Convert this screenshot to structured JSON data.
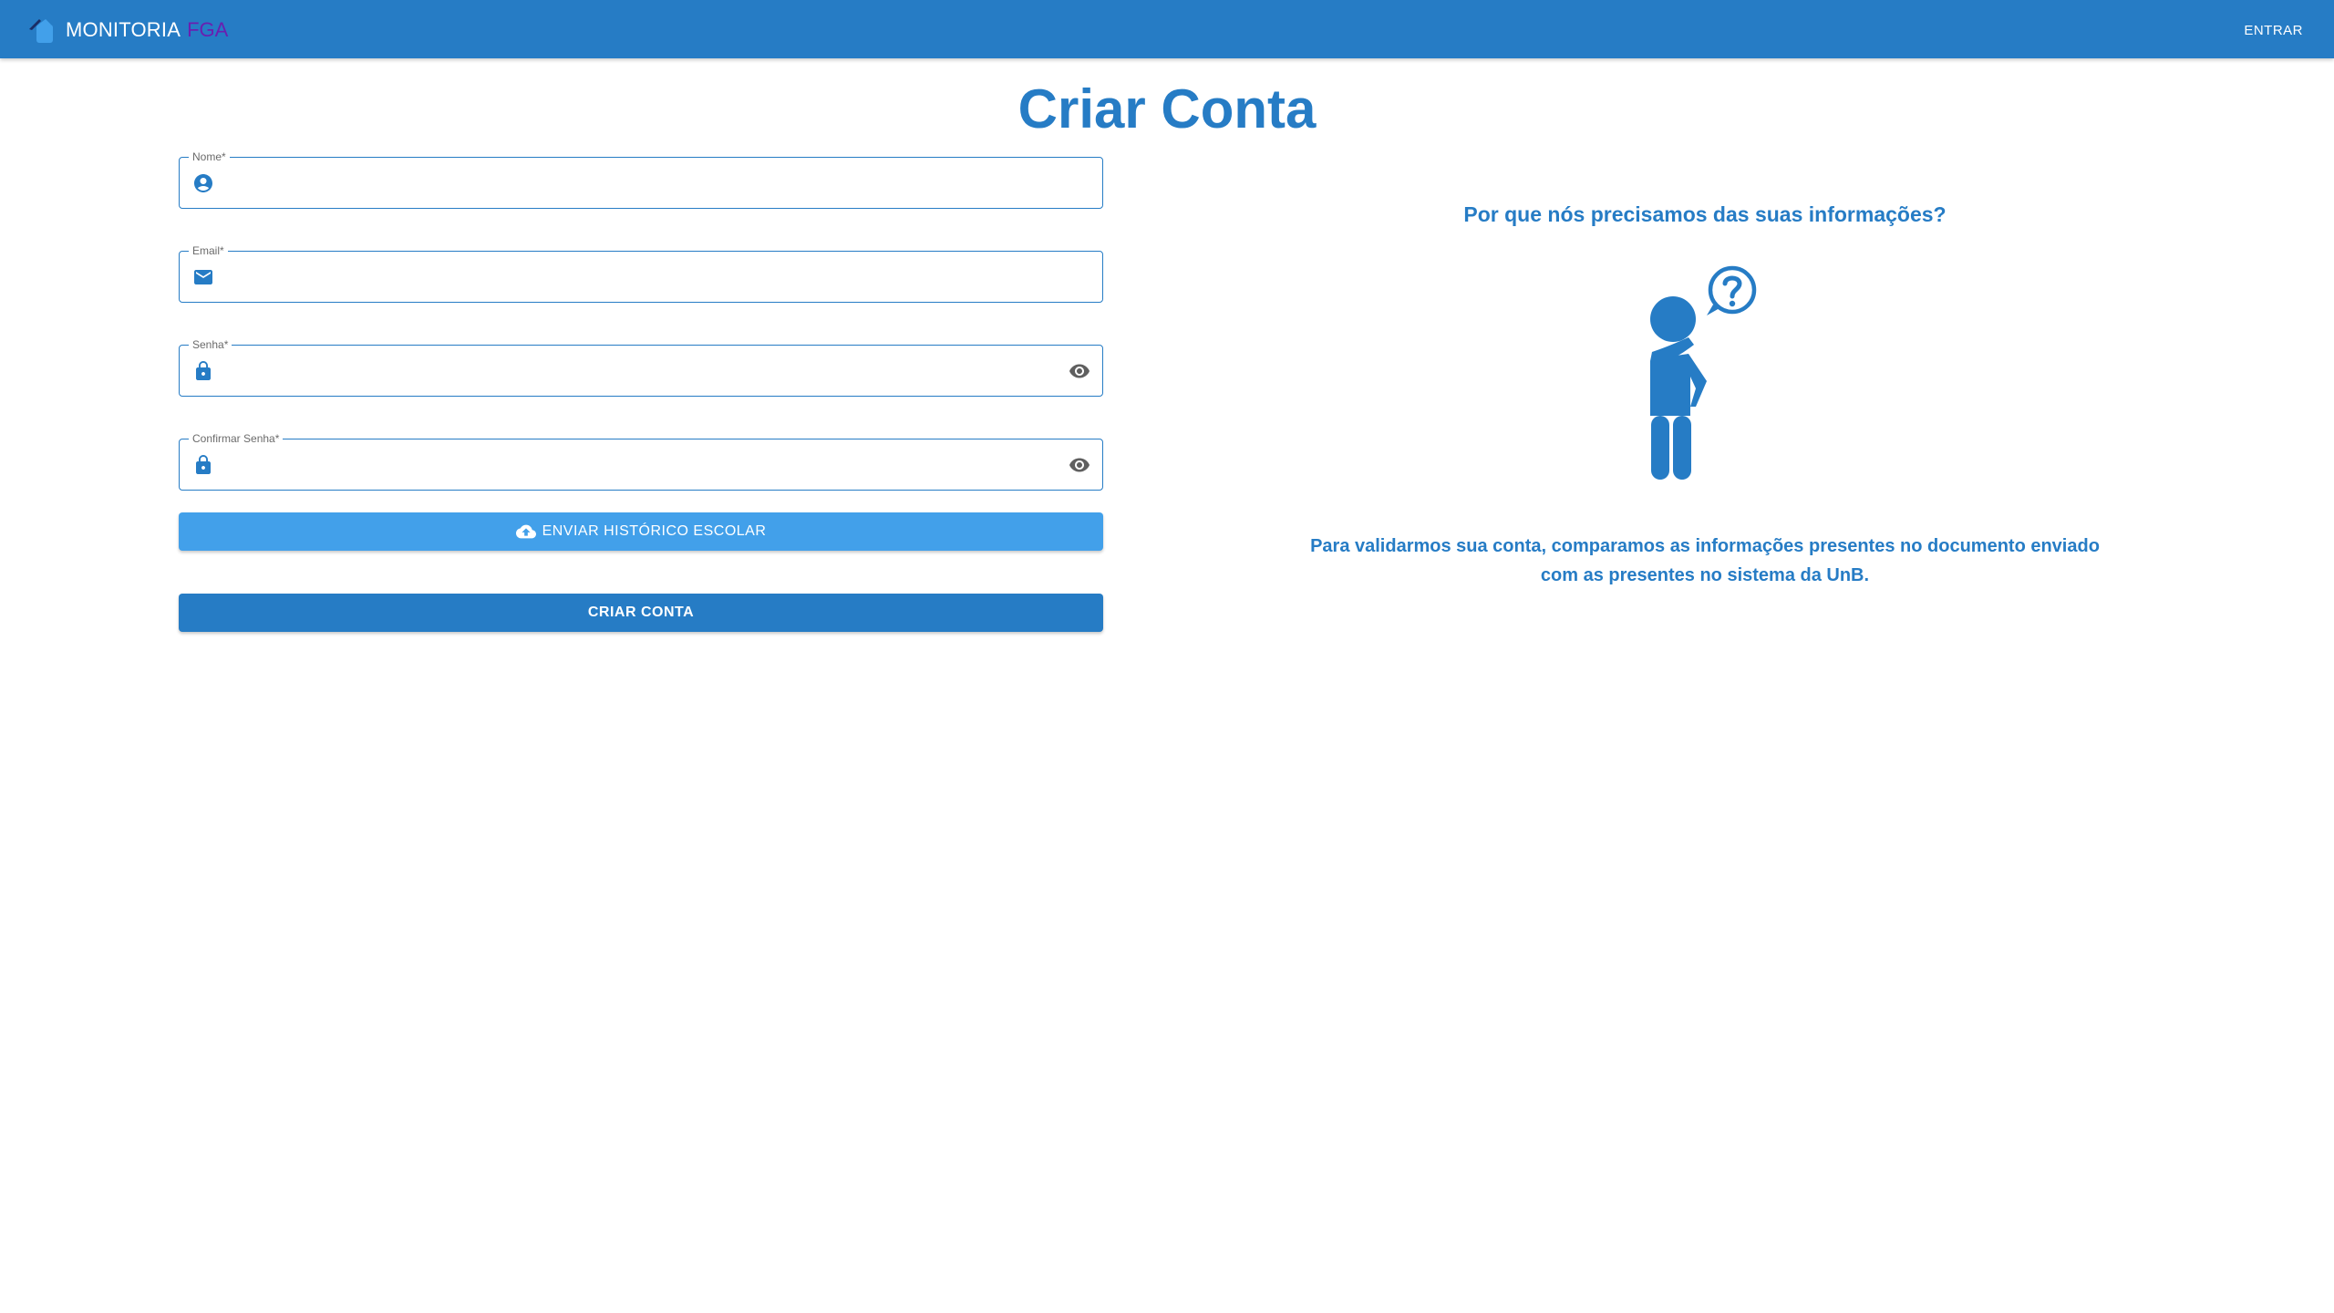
{
  "app": {
    "brand_main": "MONITORIA",
    "brand_accent": "FGA"
  },
  "header": {
    "login_label": "ENTRAR"
  },
  "page": {
    "title": "Criar Conta"
  },
  "form": {
    "fields": [
      {
        "label": "Nome*",
        "value": "",
        "icon": "account-circle-icon"
      },
      {
        "label": "Email*",
        "value": "",
        "icon": "mail-icon"
      },
      {
        "label": "Senha*",
        "value": "",
        "icon": "lock-icon",
        "toggle_icon": "eye-icon"
      },
      {
        "label": "Confirmar Senha*",
        "value": "",
        "icon": "lock-icon",
        "toggle_icon": "eye-icon"
      }
    ],
    "upload_label": "ENVIAR HISTÓRICO ESCOLAR",
    "upload_icon": "cloud-upload-icon",
    "submit_label": "CRIAR CONTA"
  },
  "info": {
    "heading": "Por que nós precisamos das suas informações?",
    "illustration": "person-question-icon",
    "text": "Para validarmos sua conta, comparamos as informações presentes no documento enviado com as presentes no sistema da UnB."
  },
  "colors": {
    "primary": "#267cc5",
    "secondary": "#42a0ea",
    "brand_accent": "#6a1fb0"
  }
}
